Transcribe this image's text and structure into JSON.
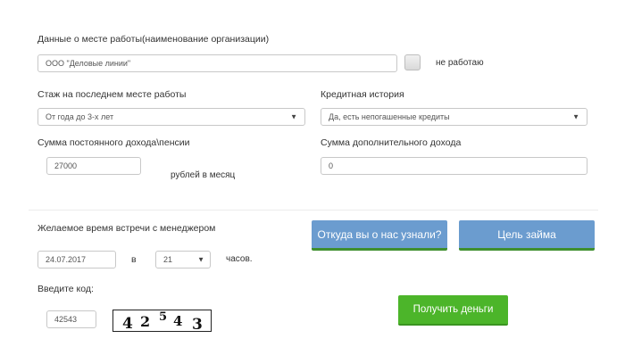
{
  "work": {
    "label": "Данные о месте работы(наименование организации)",
    "value": "ООО \"Деловые линии\"",
    "unemployed_label": "не работаю"
  },
  "experience": {
    "label": "Стаж на последнем месте работы",
    "selected": "От года до 3-х лет"
  },
  "credit": {
    "label": "Кредитная история",
    "selected": "Да, есть непогашенные кредиты"
  },
  "income": {
    "label": "Сумма постоянного дохода\\пенсии",
    "value": "27000",
    "unit": "рублей в месяц"
  },
  "extra_income": {
    "label": "Сумма дополнительного дохода",
    "value": "0"
  },
  "meeting": {
    "label": "Желаемое время встречи с менеджером",
    "date": "24.07.2017",
    "at": "в",
    "hour": "21",
    "hours_label": "часов."
  },
  "buttons": {
    "source": "Откуда вы о нас узнали?",
    "purpose": "Цель займа",
    "submit": "Получить деньги"
  },
  "code": {
    "label": "Введите код:",
    "value": "42543",
    "captcha_chars": [
      "4",
      "2",
      "5",
      "4",
      "3"
    ]
  },
  "icons": {
    "select_arrow": "▼"
  }
}
